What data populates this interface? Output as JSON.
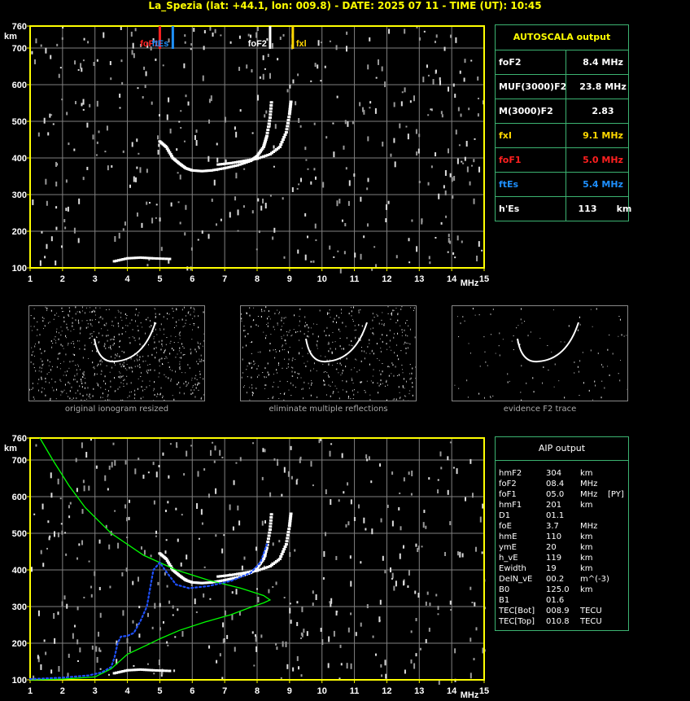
{
  "title": "La_Spezia (lat: +44.1, lon: 009.8) - DATE: 2025 07 11 - TIME (UT): 10:45",
  "colors": {
    "axis": "#ffff00",
    "grid": "#808080",
    "green": "#00ff00",
    "blue": "#1e50ff",
    "fxl": "#ffd700",
    "foF1": "#ff2020",
    "ftEs": "#1e90ff",
    "trace": "#ffffff"
  },
  "chart_data": [
    {
      "type": "scatter",
      "name_ref": "main-ionogram",
      "xlim": [
        1,
        15
      ],
      "ylim": [
        100,
        760
      ],
      "x_ticks": [
        "1",
        "2",
        "3",
        "4",
        "5",
        "6",
        "7",
        "8",
        "9",
        "10",
        "11",
        "12",
        "13",
        "14",
        "15"
      ],
      "y_ticks": [
        "760",
        "700",
        "600",
        "500",
        "400",
        "300",
        "200",
        "100"
      ],
      "xunit": "MHz",
      "yunit": "km",
      "markers": [
        {
          "label": "foF1",
          "x": 5.0
        },
        {
          "label": "ftEs",
          "x": 5.4
        },
        {
          "label": "foF2",
          "x": 8.4
        },
        {
          "label": "fxl",
          "x": 9.1
        }
      ],
      "f2_trace": [
        [
          5.0,
          445
        ],
        [
          5.2,
          430
        ],
        [
          5.4,
          400
        ],
        [
          5.6,
          385
        ],
        [
          5.8,
          372
        ],
        [
          6.0,
          366
        ],
        [
          6.3,
          364
        ],
        [
          6.6,
          366
        ],
        [
          7.0,
          372
        ],
        [
          7.4,
          380
        ],
        [
          7.8,
          392
        ],
        [
          8.0,
          405
        ],
        [
          8.2,
          430
        ],
        [
          8.3,
          460
        ],
        [
          8.4,
          510
        ],
        [
          8.45,
          560
        ]
      ],
      "f2x_trace": [
        [
          6.8,
          382
        ],
        [
          7.2,
          386
        ],
        [
          7.6,
          392
        ],
        [
          8.0,
          398
        ],
        [
          8.4,
          410
        ],
        [
          8.7,
          430
        ],
        [
          8.9,
          470
        ],
        [
          9.0,
          520
        ],
        [
          9.05,
          560
        ]
      ],
      "es_trace": [
        [
          3.6,
          118
        ],
        [
          4.0,
          126
        ],
        [
          4.4,
          128
        ],
        [
          4.8,
          126
        ],
        [
          5.4,
          124
        ]
      ]
    },
    {
      "type": "line",
      "name_ref": "aip-ionogram",
      "xlim": [
        1,
        15
      ],
      "ylim": [
        100,
        760
      ],
      "x_ticks": [
        "1",
        "2",
        "3",
        "4",
        "5",
        "6",
        "7",
        "8",
        "9",
        "10",
        "11",
        "12",
        "13",
        "14",
        "15"
      ],
      "y_ticks": [
        "760",
        "700",
        "600",
        "500",
        "400",
        "300",
        "200",
        "100"
      ],
      "xunit": "MHz",
      "yunit": "km",
      "green_profile": [
        [
          1.0,
          100
        ],
        [
          2.0,
          102
        ],
        [
          3.0,
          108
        ],
        [
          3.5,
          130
        ],
        [
          4.0,
          170
        ],
        [
          4.6,
          195
        ],
        [
          5.0,
          212
        ],
        [
          5.6,
          235
        ],
        [
          6.4,
          258
        ],
        [
          7.2,
          278
        ],
        [
          7.8,
          298
        ],
        [
          8.2,
          310
        ],
        [
          8.4,
          318
        ],
        [
          8.2,
          330
        ],
        [
          7.5,
          350
        ],
        [
          6.5,
          372
        ],
        [
          5.5,
          400
        ],
        [
          4.5,
          440
        ],
        [
          3.5,
          500
        ],
        [
          2.7,
          570
        ],
        [
          2.2,
          630
        ],
        [
          1.7,
          700
        ],
        [
          1.3,
          760
        ]
      ],
      "blue_profile": [
        [
          1.0,
          102
        ],
        [
          2.0,
          106
        ],
        [
          2.8,
          112
        ],
        [
          3.2,
          120
        ],
        [
          3.5,
          135
        ],
        [
          3.6,
          160
        ],
        [
          3.7,
          200
        ],
        [
          3.8,
          218
        ],
        [
          4.0,
          220
        ],
        [
          4.2,
          228
        ],
        [
          4.4,
          260
        ],
        [
          4.6,
          300
        ],
        [
          4.8,
          400
        ],
        [
          5.0,
          420
        ],
        [
          5.2,
          395
        ],
        [
          5.5,
          360
        ],
        [
          5.9,
          350
        ],
        [
          6.5,
          356
        ],
        [
          7.2,
          370
        ],
        [
          7.8,
          392
        ],
        [
          8.1,
          420
        ],
        [
          8.3,
          470
        ]
      ]
    }
  ],
  "autoscala": {
    "heading": "AUTOSCALA output",
    "rows": [
      {
        "label": "foF2",
        "value": "8.4 MHz",
        "color": "#ffffff"
      },
      {
        "label": "MUF(3000)F2",
        "value": "23.8 MHz",
        "color": "#ffffff"
      },
      {
        "label": "M(3000)F2",
        "value": "2.83",
        "color": "#ffffff"
      },
      {
        "label": "fxI",
        "value": "9.1 MHz",
        "color": "#ffd700"
      },
      {
        "label": "foF1",
        "value": "5.0 MHz",
        "color": "#ff2020"
      },
      {
        "label": "ftEs",
        "value": "5.4 MHz",
        "color": "#1e90ff"
      },
      {
        "label": "h'Es",
        "value": "113",
        "unit": "km",
        "color": "#ffffff"
      }
    ]
  },
  "thumbnails": [
    {
      "caption": "original ionogram resized"
    },
    {
      "caption": "eliminate multiple reflections"
    },
    {
      "caption": "evidence F2 trace"
    }
  ],
  "aip": {
    "heading": "AIP output",
    "rows": [
      {
        "name": "hmF2",
        "value": "304",
        "unit": "km",
        "extra": ""
      },
      {
        "name": "foF2",
        "value": "08.4",
        "unit": "MHz",
        "extra": ""
      },
      {
        "name": "foF1",
        "value": "05.0",
        "unit": "MHz",
        "extra": "[PY]"
      },
      {
        "name": "hmF1",
        "value": "201",
        "unit": "km",
        "extra": ""
      },
      {
        "name": "D1",
        "value": "01.1",
        "unit": "",
        "extra": ""
      },
      {
        "name": "foE",
        "value": "3.7",
        "unit": "MHz",
        "extra": ""
      },
      {
        "name": "hmE",
        "value": "110",
        "unit": "km",
        "extra": ""
      },
      {
        "name": "ymE",
        "value": "20",
        "unit": "km",
        "extra": ""
      },
      {
        "name": "h_vE",
        "value": "119",
        "unit": "km",
        "extra": ""
      },
      {
        "name": "Ewidth",
        "value": "19",
        "unit": "km",
        "extra": ""
      },
      {
        "name": "DelN_vE",
        "value": "00.2",
        "unit": "m^(-3)",
        "extra": ""
      },
      {
        "name": "B0",
        "value": "125.0",
        "unit": "km",
        "extra": ""
      },
      {
        "name": "B1",
        "value": "01.6",
        "unit": "",
        "extra": ""
      },
      {
        "name": "TEC[Bot]",
        "value": "008.9",
        "unit": "TECU",
        "extra": ""
      },
      {
        "name": "TEC[Top]",
        "value": "010.8",
        "unit": "TECU",
        "extra": ""
      }
    ]
  }
}
